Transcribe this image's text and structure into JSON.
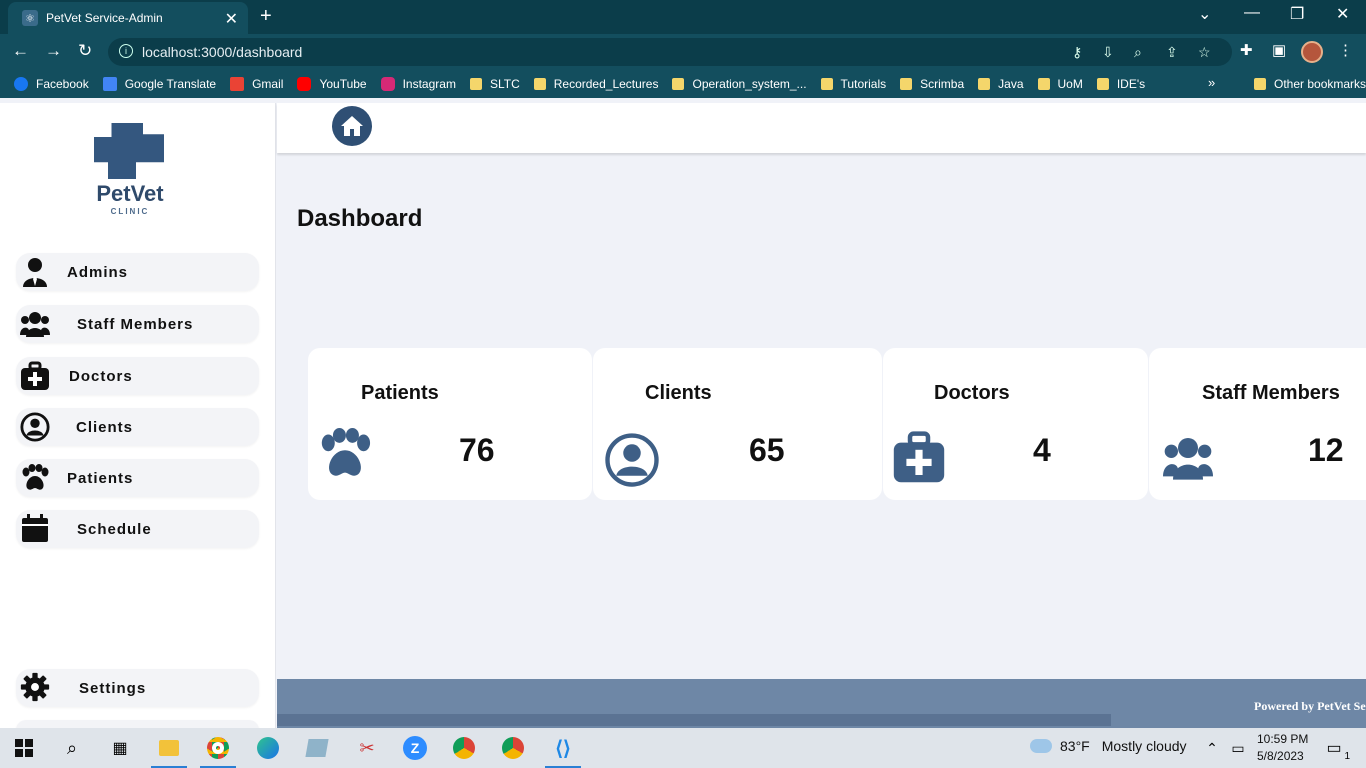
{
  "browser": {
    "tab_title": "PetVet Service-Admin",
    "url": "localhost:3000/dashboard",
    "bookmarks": [
      "Facebook",
      "Google Translate",
      "Gmail",
      "YouTube",
      "Instagram",
      "SLTC",
      "Recorded_Lectures",
      "Operation_system_...",
      "Tutorials",
      "Scrimba",
      "Java",
      "UoM",
      "IDE's"
    ],
    "bookmarks_more": "»",
    "other_bookmarks": "Other bookmarks"
  },
  "logo": {
    "name": "PetVet",
    "sub": "CLINIC"
  },
  "sidebar": {
    "items": [
      {
        "label": "Admins",
        "icon": "admin-icon"
      },
      {
        "label": "Staff Members",
        "icon": "users-icon"
      },
      {
        "label": "Doctors",
        "icon": "medkit-icon"
      },
      {
        "label": "Clients",
        "icon": "user-circle-icon"
      },
      {
        "label": "Patients",
        "icon": "paw-icon"
      },
      {
        "label": "Schedule",
        "icon": "calendar-icon"
      }
    ],
    "settings": {
      "label": "Settings",
      "icon": "gear-icon"
    }
  },
  "main": {
    "title": "Dashboard",
    "cards": [
      {
        "label": "Patients",
        "value": "76",
        "icon": "paw-icon"
      },
      {
        "label": "Clients",
        "value": "65",
        "icon": "user-circle-icon"
      },
      {
        "label": "Doctors",
        "value": "4",
        "icon": "medkit-icon"
      },
      {
        "label": "Staff Members",
        "value": "12",
        "icon": "users-icon"
      }
    ]
  },
  "footer": {
    "text": "Powered by PetVet Se"
  },
  "taskbar": {
    "weather_temp": "83°F",
    "weather_desc": "Mostly cloudy",
    "time": "10:59 PM",
    "date": "5/8/2023",
    "notif_count": "1"
  },
  "colors": {
    "brand": "#2f4f74",
    "chrome": "#134e5e",
    "footer": "#6e87a6"
  }
}
